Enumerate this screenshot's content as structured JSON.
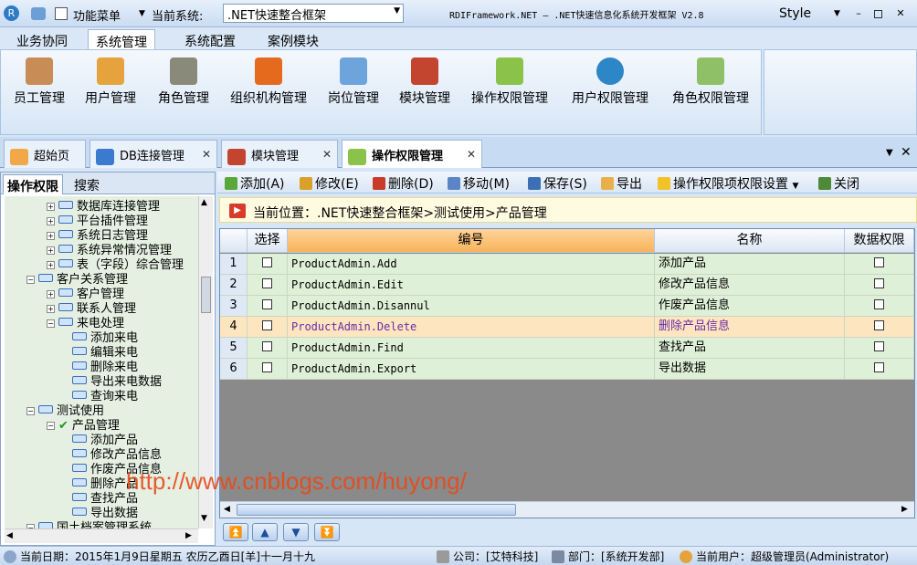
{
  "titlebar": {
    "menu_label": "功能菜单",
    "system_label": "当前系统:",
    "system_value": ".NET快速整合框架",
    "window_title": "RDIFramework.NET — .NET快速信息化系统开发框架 V2.8",
    "style_label": "Style"
  },
  "menutabs": [
    "业务协同",
    "系统管理",
    "系统配置",
    "案例模块"
  ],
  "ribbon": [
    "员工管理",
    "用户管理",
    "角色管理",
    "组织机构管理",
    "岗位管理",
    "模块管理",
    "操作权限管理",
    "用户权限管理",
    "角色权限管理"
  ],
  "doctabs": [
    "超始页",
    "DB连接管理",
    "模块管理",
    "操作权限管理"
  ],
  "lefttabs": [
    "操作权限",
    "搜索"
  ],
  "tree": [
    "数据库连接管理",
    "平台插件管理",
    "系统日志管理",
    "系统异常情况管理",
    "表（字段）综合管理",
    "客户关系管理",
    "客户管理",
    "联系人管理",
    "来电处理",
    "添加来电",
    "编辑来电",
    "删除来电",
    "导出来电数据",
    "查询来电",
    "测试使用",
    "产品管理",
    "添加产品",
    "修改产品信息",
    "作废产品信息",
    "删除产品",
    "查找产品",
    "导出数据",
    "国土档案管理系统"
  ],
  "toolbar": {
    "add": "添加(A)",
    "edit": "修改(E)",
    "delete": "删除(D)",
    "move": "移动(M)",
    "save": "保存(S)",
    "export": "导出",
    "perm": "操作权限项权限设置",
    "close": "关闭"
  },
  "crumb": "当前位置：.NET快速整合框架>测试使用>产品管理",
  "grid": {
    "headers": [
      "选择",
      "编号",
      "名称",
      "数据权限"
    ],
    "rows": [
      {
        "n": "1",
        "code": "ProductAdmin.Add",
        "name": "添加产品"
      },
      {
        "n": "2",
        "code": "ProductAdmin.Edit",
        "name": "修改产品信息"
      },
      {
        "n": "3",
        "code": "ProductAdmin.Disannul",
        "name": "作废产品信息"
      },
      {
        "n": "4",
        "code": "ProductAdmin.Delete",
        "name": "删除产品信息"
      },
      {
        "n": "5",
        "code": "ProductAdmin.Find",
        "name": "查找产品"
      },
      {
        "n": "6",
        "code": "ProductAdmin.Export",
        "name": "导出数据"
      }
    ]
  },
  "status": {
    "date": "当前日期：2015年1月9日星期五 农历乙酉日[羊]十一月十九",
    "company": "公司：[艾特科技]",
    "dept": "部门：[系统开发部]",
    "user": "当前用户：超级管理员(Administrator)"
  },
  "watermark": "http://www.cnblogs.com/huyong/",
  "colors": {
    "accent": "#f6b45a",
    "selected_row": "#fde6bf",
    "tree_bg": "#e6f0e2",
    "row_bg": "#dff0d8"
  }
}
